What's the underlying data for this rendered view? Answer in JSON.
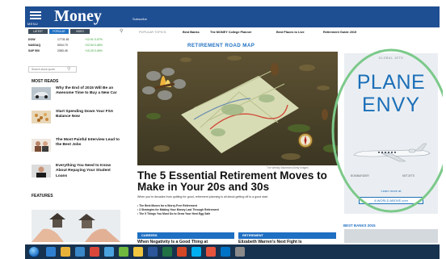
{
  "header": {
    "menu_label": "MENU",
    "logo": "Money",
    "subscribe": "Subscribe",
    "brand_color": "#1f4f93"
  },
  "markets": {
    "tabs": [
      "LATEST",
      "POPULAR",
      "VIDEO"
    ],
    "rows": [
      {
        "name": "DOW",
        "value": "17731.81",
        "change": "+12.91 0.07%"
      },
      {
        "name": "NASDAQ",
        "value": "5004.79",
        "change": "+22.54 0.45%"
      },
      {
        "name": "S&P 500",
        "value": "2083.45",
        "change": "+10.20 0.49%"
      }
    ],
    "quote_placeholder": "Search stock quote"
  },
  "most_reads": {
    "heading": "MOST READS",
    "items": [
      {
        "title": "Why the End of 2015 Will Be an Awesome Time to Buy a New Car"
      },
      {
        "title": "Start Spending Down Your FSA Balance Now"
      },
      {
        "title": "The Most Painful Interview Lead to the Best Jobs"
      },
      {
        "title": "Everything You Need to Know About Repaying Your Student Loans"
      }
    ]
  },
  "features": {
    "heading": "FEATURES"
  },
  "topnav": {
    "label": "POPULAR TOPICS:",
    "items": [
      "Best Banks",
      "The MONEY College Planner",
      "Best Places to Live",
      "Retirement Guide 2015"
    ]
  },
  "article": {
    "section": "RETIREMENT ROAD MAP",
    "photo_credit": "The Weekly Bachelors/Getty Images",
    "headline": "The 5 Essential Retirement Moves to Make in Your 20s and 30s",
    "deck": "When you're decades from quitting for good, retirement planning is all about getting off to a good start.",
    "bullets": [
      "The Best Moves for a Worry-Free Retirement",
      "3 Strategies for Making Your Money Last Through Retirement",
      "The 5 Things You Must Do to Grow Your Nest Egg Safe"
    ]
  },
  "categories": [
    {
      "label": "CAREERS",
      "headline": "When Negativity Is a Good Thing at"
    },
    {
      "label": "RETIREMENT",
      "headline": "Elizabeth Warren's Next Fight Is"
    }
  ],
  "ad": {
    "global": "GLOBAL JETS",
    "line1": "PLANE",
    "line2": "ENVY",
    "small_left": "BOMBARDIER",
    "small_right": "NETJETS",
    "learn": "Learn more at",
    "url": "A WORLD ABOVE.com",
    "ring_color": "#7cc98a"
  },
  "best_banks": {
    "label": "BEST BANKS 2015"
  },
  "taskbar": {
    "icons": [
      "start-orb",
      "ie-icon",
      "explorer-icon",
      "media-icon",
      "chrome-icon",
      "mail-icon",
      "calendar-icon",
      "photos-icon",
      "word-icon",
      "excel-icon",
      "powerpoint-icon",
      "skype-icon",
      "itunes-icon",
      "outlook-icon",
      "settings-icon"
    ]
  }
}
